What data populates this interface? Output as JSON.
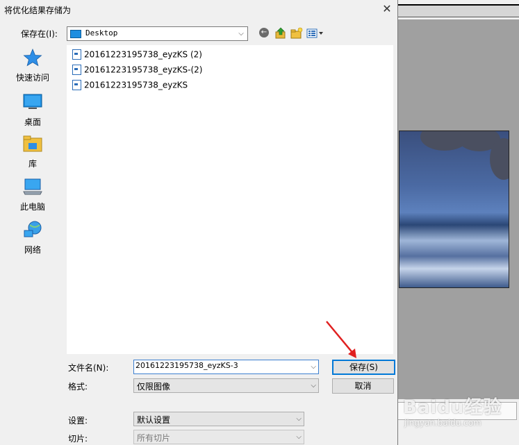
{
  "dialog": {
    "title": "将优化结果存储为",
    "close_glyph": "✕"
  },
  "location": {
    "label": "保存在(I):",
    "value": "Desktop"
  },
  "places": [
    {
      "label": "快速访问",
      "icon": "star-icon"
    },
    {
      "label": "桌面",
      "icon": "desktop-icon"
    },
    {
      "label": "库",
      "icon": "library-folder-icon"
    },
    {
      "label": "此电脑",
      "icon": "computer-icon"
    },
    {
      "label": "网络",
      "icon": "network-icon"
    }
  ],
  "files": [
    "20161223195738_eyzKS (2)",
    "20161223195738_eyzKS-(2)",
    "20161223195738_eyzKS"
  ],
  "form": {
    "filename_label": "文件名(N):",
    "filename_value": "20161223195738_eyzKS-3",
    "format_label": "格式:",
    "format_value": "仅限图像",
    "settings_label": "设置:",
    "settings_value": "默认设置",
    "slices_label": "切片:",
    "slices_value": "所有切片"
  },
  "buttons": {
    "save": "保存(S)",
    "cancel": "取消"
  },
  "watermark": {
    "main": "Baidu经验",
    "sub": "jingyan.baidu.com"
  },
  "colors": {
    "accent": "#0078d7",
    "arrow": "#e02020"
  }
}
